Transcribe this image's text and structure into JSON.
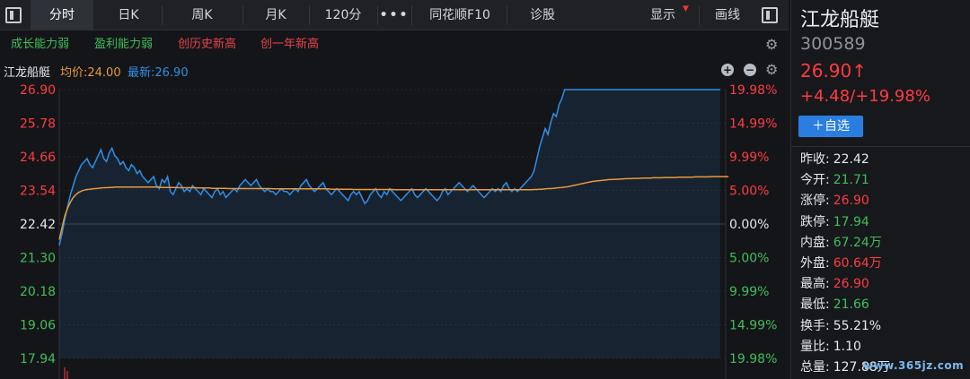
{
  "toolbar": {
    "tabs": [
      "分时",
      "日K",
      "周K",
      "月K",
      "120分"
    ],
    "more": "•••",
    "f10": "同花顺F10",
    "diagnose": "诊股",
    "display": "显示",
    "draw": "画线"
  },
  "tags": [
    "成长能力弱",
    "盈利能力弱",
    "创历史新高",
    "创一年新高"
  ],
  "chart_header": {
    "name": "江龙船艇",
    "avg": "均价:24.00",
    "latest": "最新:26.90"
  },
  "chart_data": {
    "type": "line",
    "y_price_ticks": [
      "26.90",
      "25.78",
      "24.66",
      "23.54",
      "22.42",
      "21.30",
      "20.18",
      "19.06",
      "17.94"
    ],
    "y_pct_ticks": [
      "19.98%",
      "14.99%",
      "9.99%",
      "5.00%",
      "0.00%",
      "5.00%",
      "9.99%",
      "14.99%",
      "19.98%"
    ],
    "ylim": [
      17.94,
      26.9
    ],
    "prev_close": 22.42,
    "sessions_minutes": 241,
    "series": [
      {
        "name": "最新",
        "color": "#2e8fe8",
        "values": [
          21.71,
          22.1,
          22.6,
          23.0,
          23.4,
          23.7,
          24.0,
          24.2,
          24.4,
          24.5,
          24.6,
          24.4,
          24.3,
          24.5,
          24.7,
          24.9,
          24.6,
          24.5,
          24.8,
          24.95,
          24.7,
          24.6,
          24.4,
          24.5,
          24.3,
          24.2,
          24.4,
          24.3,
          24.1,
          24.2,
          24.0,
          23.9,
          23.8,
          23.9,
          24.0,
          23.7,
          23.6,
          23.9,
          23.8,
          24.0,
          23.5,
          23.4,
          23.6,
          23.8,
          23.7,
          23.5,
          23.6,
          23.5,
          23.7,
          23.6,
          23.5,
          23.4,
          23.6,
          23.5,
          23.4,
          23.3,
          23.5,
          23.6,
          23.4,
          23.5,
          23.3,
          23.4,
          23.5,
          23.6,
          23.5,
          23.7,
          23.8,
          23.9,
          23.8,
          23.7,
          23.8,
          23.9,
          23.7,
          23.6,
          23.5,
          23.6,
          23.5,
          23.5,
          23.4,
          23.5,
          23.6,
          23.5,
          23.5,
          23.4,
          23.5,
          23.6,
          23.5,
          23.7,
          23.8,
          23.9,
          23.7,
          23.6,
          23.5,
          23.6,
          23.7,
          23.8,
          23.6,
          23.5,
          23.4,
          23.5,
          23.6,
          23.5,
          23.4,
          23.3,
          23.2,
          23.4,
          23.5,
          23.4,
          23.5,
          23.3,
          23.1,
          23.2,
          23.4,
          23.5,
          23.6,
          23.4,
          23.3,
          23.5,
          23.4,
          23.6,
          23.5,
          23.4,
          23.3,
          23.2,
          23.3,
          23.4,
          23.5,
          23.6,
          23.4,
          23.3,
          23.4,
          23.5,
          23.6,
          23.5,
          23.4,
          23.3,
          23.2,
          23.3,
          23.5,
          23.6,
          23.4,
          23.5,
          23.6,
          23.7,
          23.8,
          23.7,
          23.6,
          23.5,
          23.6,
          23.7,
          23.6,
          23.5,
          23.4,
          23.3,
          23.4,
          23.5,
          23.6,
          23.5,
          23.6,
          23.5,
          23.7,
          23.8,
          23.6,
          23.5,
          23.6,
          23.5,
          23.6,
          23.7,
          23.8,
          23.9,
          24.0,
          24.2,
          24.6,
          25.0,
          25.3,
          25.6,
          25.4,
          25.8,
          26.1,
          26.0,
          26.4,
          26.6,
          26.9,
          26.9,
          26.9,
          26.9,
          26.9,
          26.9,
          26.9,
          26.9,
          26.9,
          26.9,
          26.9,
          26.9,
          26.9,
          26.9,
          26.9,
          26.9,
          26.9,
          26.9,
          26.9,
          26.9,
          26.9,
          26.9,
          26.9,
          26.9,
          26.9,
          26.9,
          26.9,
          26.9,
          26.9,
          26.9,
          26.9,
          26.9,
          26.9,
          26.9,
          26.9,
          26.9,
          26.9,
          26.9,
          26.9,
          26.9,
          26.9,
          26.9,
          26.9,
          26.9,
          26.9,
          26.9,
          26.9,
          26.9,
          26.9,
          26.9,
          26.9,
          26.9,
          26.9,
          26.9,
          26.9,
          26.9,
          26.9
        ]
      },
      {
        "name": "均价",
        "color": "#e89a3c",
        "values": [
          21.9,
          22.3,
          22.7,
          22.95,
          23.15,
          23.3,
          23.4,
          23.47,
          23.52,
          23.55,
          23.57,
          23.58,
          23.59,
          23.6,
          23.61,
          23.62,
          23.63,
          23.63,
          23.64,
          23.64,
          23.65,
          23.65,
          23.65,
          23.65,
          23.65,
          23.65,
          23.65,
          23.65,
          23.65,
          23.65,
          23.65,
          23.65,
          23.65,
          23.65,
          23.65,
          23.65,
          23.65,
          23.64,
          23.64,
          23.64,
          23.64,
          23.64,
          23.64,
          23.63,
          23.63,
          23.63,
          23.63,
          23.63,
          23.63,
          23.63,
          23.62,
          23.62,
          23.62,
          23.62,
          23.62,
          23.61,
          23.61,
          23.61,
          23.61,
          23.61,
          23.61,
          23.6,
          23.6,
          23.6,
          23.6,
          23.6,
          23.6,
          23.6,
          23.6,
          23.6,
          23.6,
          23.6,
          23.6,
          23.6,
          23.6,
          23.6,
          23.6,
          23.59,
          23.59,
          23.59,
          23.59,
          23.59,
          23.59,
          23.59,
          23.59,
          23.59,
          23.59,
          23.59,
          23.59,
          23.59,
          23.59,
          23.59,
          23.59,
          23.59,
          23.59,
          23.59,
          23.59,
          23.59,
          23.58,
          23.58,
          23.58,
          23.58,
          23.58,
          23.58,
          23.58,
          23.58,
          23.57,
          23.57,
          23.57,
          23.57,
          23.57,
          23.57,
          23.57,
          23.57,
          23.57,
          23.57,
          23.57,
          23.57,
          23.57,
          23.57,
          23.57,
          23.56,
          23.56,
          23.56,
          23.56,
          23.56,
          23.56,
          23.56,
          23.56,
          23.56,
          23.56,
          23.56,
          23.56,
          23.56,
          23.56,
          23.56,
          23.56,
          23.56,
          23.56,
          23.56,
          23.56,
          23.56,
          23.56,
          23.56,
          23.56,
          23.56,
          23.56,
          23.56,
          23.56,
          23.56,
          23.56,
          23.56,
          23.56,
          23.56,
          23.56,
          23.56,
          23.56,
          23.56,
          23.56,
          23.56,
          23.56,
          23.56,
          23.56,
          23.56,
          23.56,
          23.56,
          23.56,
          23.56,
          23.56,
          23.56,
          23.56,
          23.57,
          23.57,
          23.58,
          23.58,
          23.59,
          23.6,
          23.6,
          23.61,
          23.62,
          23.63,
          23.64,
          23.65,
          23.66,
          23.68,
          23.7,
          23.72,
          23.74,
          23.76,
          23.78,
          23.8,
          23.82,
          23.84,
          23.85,
          23.86,
          23.87,
          23.88,
          23.89,
          23.9,
          23.9,
          23.91,
          23.91,
          23.92,
          23.92,
          23.93,
          23.93,
          23.93,
          23.94,
          23.94,
          23.94,
          23.95,
          23.95,
          23.95,
          23.95,
          23.96,
          23.96,
          23.96,
          23.96,
          23.97,
          23.97,
          23.97,
          23.97,
          23.97,
          23.98,
          23.98,
          23.98,
          23.98,
          23.98,
          23.98,
          23.99,
          23.99,
          23.99,
          23.99,
          23.99,
          23.99,
          24.0,
          24.0,
          24.0,
          24.0,
          24.0,
          24.0,
          24.0
        ]
      }
    ]
  },
  "right_panel": {
    "name": "江龙船艇",
    "code": "300589",
    "price": "26.90↑",
    "change": "+4.48/+19.98%",
    "watch_button": "＋自选",
    "stats": [
      {
        "label": "昨收:",
        "value": "22.42",
        "color": "white"
      },
      {
        "label": "今开:",
        "value": "21.71",
        "color": "green"
      },
      {
        "label": "涨停:",
        "value": "26.90",
        "color": "red"
      },
      {
        "label": "跌停:",
        "value": "17.94",
        "color": "green"
      },
      {
        "label": "内盘:",
        "value": "67.24万",
        "color": "green"
      },
      {
        "label": "外盘:",
        "value": "60.64万",
        "color": "red"
      },
      {
        "label": "最高:",
        "value": "26.90",
        "color": "red"
      },
      {
        "label": "最低:",
        "value": "21.66",
        "color": "green"
      },
      {
        "label": "换手:",
        "value": "55.21%",
        "color": "white"
      },
      {
        "label": "量比:",
        "value": "1.10",
        "color": "white"
      },
      {
        "label": "总量:",
        "value": "127.88万",
        "color": "white"
      }
    ],
    "watermark": "www.365jz.com"
  }
}
